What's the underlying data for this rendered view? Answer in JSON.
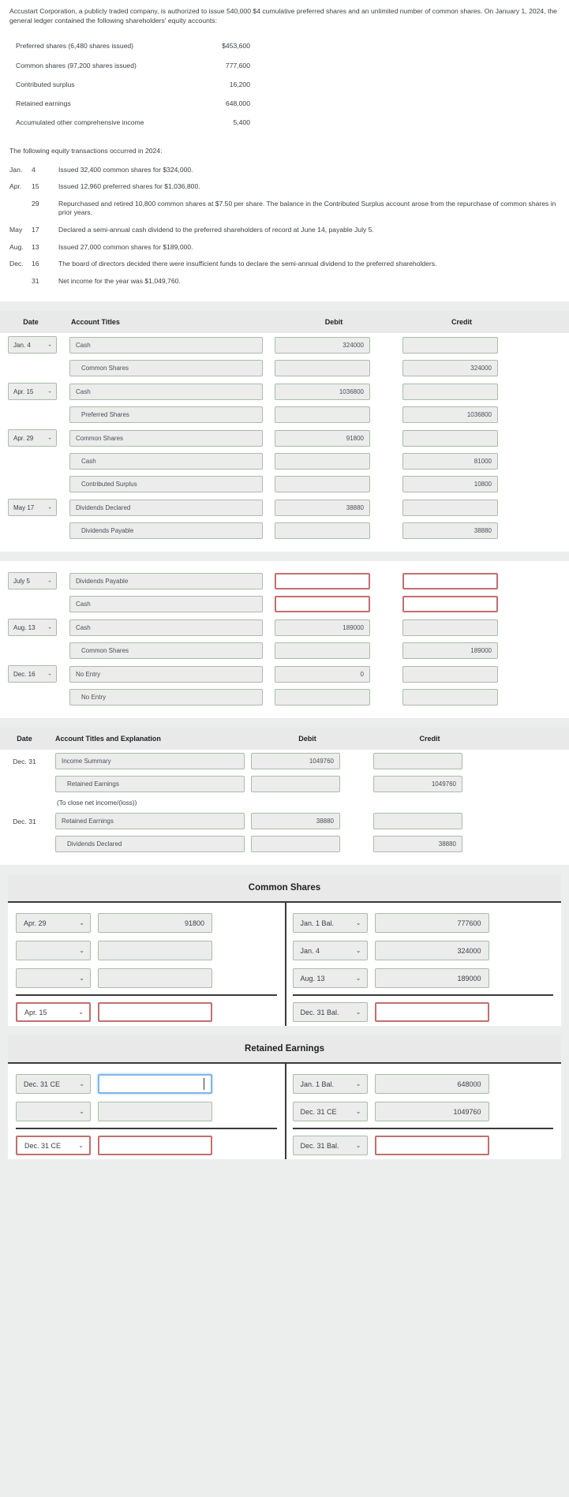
{
  "problem": {
    "paragraph": "Accustart Corporation, a publicly traded company, is authorized to issue 540,000 $4 cumulative preferred shares and an unlimited number of common shares. On January 1, 2024, the general ledger contained the following shareholders' equity accounts:",
    "equity_accounts": [
      {
        "label": "Preferred shares (6,480 shares issued)",
        "amount": "$453,600"
      },
      {
        "label": "Common shares (97,200 shares issued)",
        "amount": "777,600"
      },
      {
        "label": "Contributed surplus",
        "amount": "16,200"
      },
      {
        "label": "Retained earnings",
        "amount": "648,000"
      },
      {
        "label": "Accumulated other comprehensive income",
        "amount": "5,400"
      }
    ],
    "transactions_intro": "The following equity transactions occurred in 2024:",
    "transactions": [
      {
        "month": "Jan.",
        "day": "4",
        "desc": "Issued 32,400 common shares for $324,000."
      },
      {
        "month": "Apr.",
        "day": "15",
        "desc": "Issued 12,960 preferred shares for $1,036,800."
      },
      {
        "month": "",
        "day": "29",
        "desc": "Repurchased and retired 10,800 common shares at $7.50 per share. The balance in the Contributed Surplus account arose from the repurchase of common shares in prior years."
      },
      {
        "month": "May",
        "day": "17",
        "desc": "Declared a semi-annual cash dividend to the preferred shareholders of record at June 14, payable July 5."
      },
      {
        "month": "Aug.",
        "day": "13",
        "desc": "Issued 27,000 common shares for $189,000."
      },
      {
        "month": "Dec.",
        "day": "16",
        "desc": "The board of directors decided there were insufficient funds to declare the semi-annual dividend to the preferred shareholders."
      },
      {
        "month": "",
        "day": "31",
        "desc": "Net income for the year was $1,049,760."
      }
    ]
  },
  "journal1": {
    "headers": {
      "date": "Date",
      "account": "Account Titles",
      "debit": "Debit",
      "credit": "Credit"
    },
    "rows": [
      {
        "date": "Jan. 4",
        "account": "Cash",
        "indent": false,
        "debit": "324000",
        "credit": ""
      },
      {
        "date": "",
        "account": "Common Shares",
        "indent": true,
        "debit": "",
        "credit": "324000"
      },
      {
        "date": "Apr. 15",
        "account": "Cash",
        "indent": false,
        "debit": "1036800",
        "credit": ""
      },
      {
        "date": "",
        "account": "Preferred Shares",
        "indent": true,
        "debit": "",
        "credit": "1036800"
      },
      {
        "date": "Apr. 29",
        "account": "Common Shares",
        "indent": false,
        "debit": "91800",
        "credit": ""
      },
      {
        "date": "",
        "account": "Cash",
        "indent": true,
        "debit": "",
        "credit": "81000"
      },
      {
        "date": "",
        "account": "Contributed Surplus",
        "indent": true,
        "debit": "",
        "credit": "10800"
      },
      {
        "date": "May 17",
        "account": "Dividends Declared",
        "indent": false,
        "debit": "38880",
        "credit": ""
      },
      {
        "date": "",
        "account": "Dividends Payable",
        "indent": true,
        "debit": "",
        "credit": "38880"
      }
    ]
  },
  "journal2": {
    "rows": [
      {
        "date": "July 5",
        "account": "Dividends Payable",
        "indent": false,
        "debit": "",
        "credit": "",
        "debit_error": true,
        "credit_error": true
      },
      {
        "date": "",
        "account": "Cash",
        "indent": false,
        "debit": "",
        "credit": "",
        "debit_error": true,
        "credit_error": true
      },
      {
        "date": "Aug. 13",
        "account": "Cash",
        "indent": false,
        "debit": "189000",
        "credit": "",
        "debit_error": false,
        "credit_error": false
      },
      {
        "date": "",
        "account": "Common Shares",
        "indent": true,
        "debit": "",
        "credit": "189000",
        "debit_error": false,
        "credit_error": false
      },
      {
        "date": "Dec. 16",
        "account": "No Entry",
        "indent": false,
        "debit": "0",
        "credit": "",
        "debit_error": false,
        "credit_error": false
      },
      {
        "date": "",
        "account": "No Entry",
        "indent": true,
        "debit": "",
        "credit": "",
        "debit_error": false,
        "credit_error": false
      }
    ]
  },
  "journal3": {
    "headers": {
      "date": "Date",
      "account": "Account Titles and Explanation",
      "debit": "Debit",
      "credit": "Credit"
    },
    "rows": [
      {
        "date": "Dec. 31",
        "account": "Income Summary",
        "indent": false,
        "debit": "1049760",
        "credit": "",
        "type": "entry"
      },
      {
        "date": "",
        "account": "Retained Earnings",
        "indent": true,
        "debit": "",
        "credit": "1049760",
        "type": "entry"
      },
      {
        "explanation": "(To close net income/(loss))",
        "type": "note"
      },
      {
        "date": "Dec. 31",
        "account": "Retained Earnings",
        "indent": false,
        "debit": "38880",
        "credit": "",
        "type": "entry"
      },
      {
        "date": "",
        "account": "Dividends Declared",
        "indent": true,
        "debit": "",
        "credit": "38880",
        "type": "entry"
      }
    ]
  },
  "t_accounts": [
    {
      "title": "Common Shares",
      "left": [
        {
          "date": "Apr. 29",
          "amount": "91800",
          "date_error": false,
          "amount_error": false,
          "total": false
        },
        {
          "date": "",
          "amount": "",
          "date_error": false,
          "amount_error": false,
          "total": false
        },
        {
          "date": "",
          "amount": "",
          "date_error": false,
          "amount_error": false,
          "total": false
        },
        {
          "date": "Apr. 15",
          "amount": "",
          "date_error": true,
          "amount_error": true,
          "total": true
        }
      ],
      "right": [
        {
          "date": "Jan. 1 Bal.",
          "amount": "777600",
          "date_error": false,
          "amount_error": false,
          "total": false
        },
        {
          "date": "Jan. 4",
          "amount": "324000",
          "date_error": false,
          "amount_error": false,
          "total": false
        },
        {
          "date": "Aug. 13",
          "amount": "189000",
          "date_error": false,
          "amount_error": false,
          "total": false
        },
        {
          "date": "Dec. 31 Bal.",
          "amount": "",
          "date_error": false,
          "amount_error": true,
          "total": true
        }
      ]
    },
    {
      "title": "Retained Earnings",
      "left": [
        {
          "date": "Dec. 31 CE",
          "amount": "",
          "date_error": false,
          "amount_error": false,
          "amount_focused": true,
          "total": false
        },
        {
          "date": "",
          "amount": "",
          "date_error": false,
          "amount_error": false,
          "total": false
        },
        {
          "date": "Dec. 31 CE",
          "amount": "",
          "date_error": true,
          "amount_error": true,
          "total": true
        }
      ],
      "right": [
        {
          "date": "Jan. 1 Bal.",
          "amount": "648000",
          "date_error": false,
          "amount_error": false,
          "total": false
        },
        {
          "date": "Dec. 31 CE",
          "amount": "1049760",
          "date_error": false,
          "amount_error": false,
          "total": false
        },
        {
          "date": "Dec. 31 Bal.",
          "amount": "",
          "date_error": false,
          "amount_error": true,
          "total": true
        }
      ]
    }
  ],
  "icons": {
    "chevron_down": "⌄"
  },
  "colors": {
    "error_border": "#c26f6f",
    "field_border": "#a8bda8",
    "field_bg": "#ececec",
    "focus_border": "#7fb6e8"
  }
}
